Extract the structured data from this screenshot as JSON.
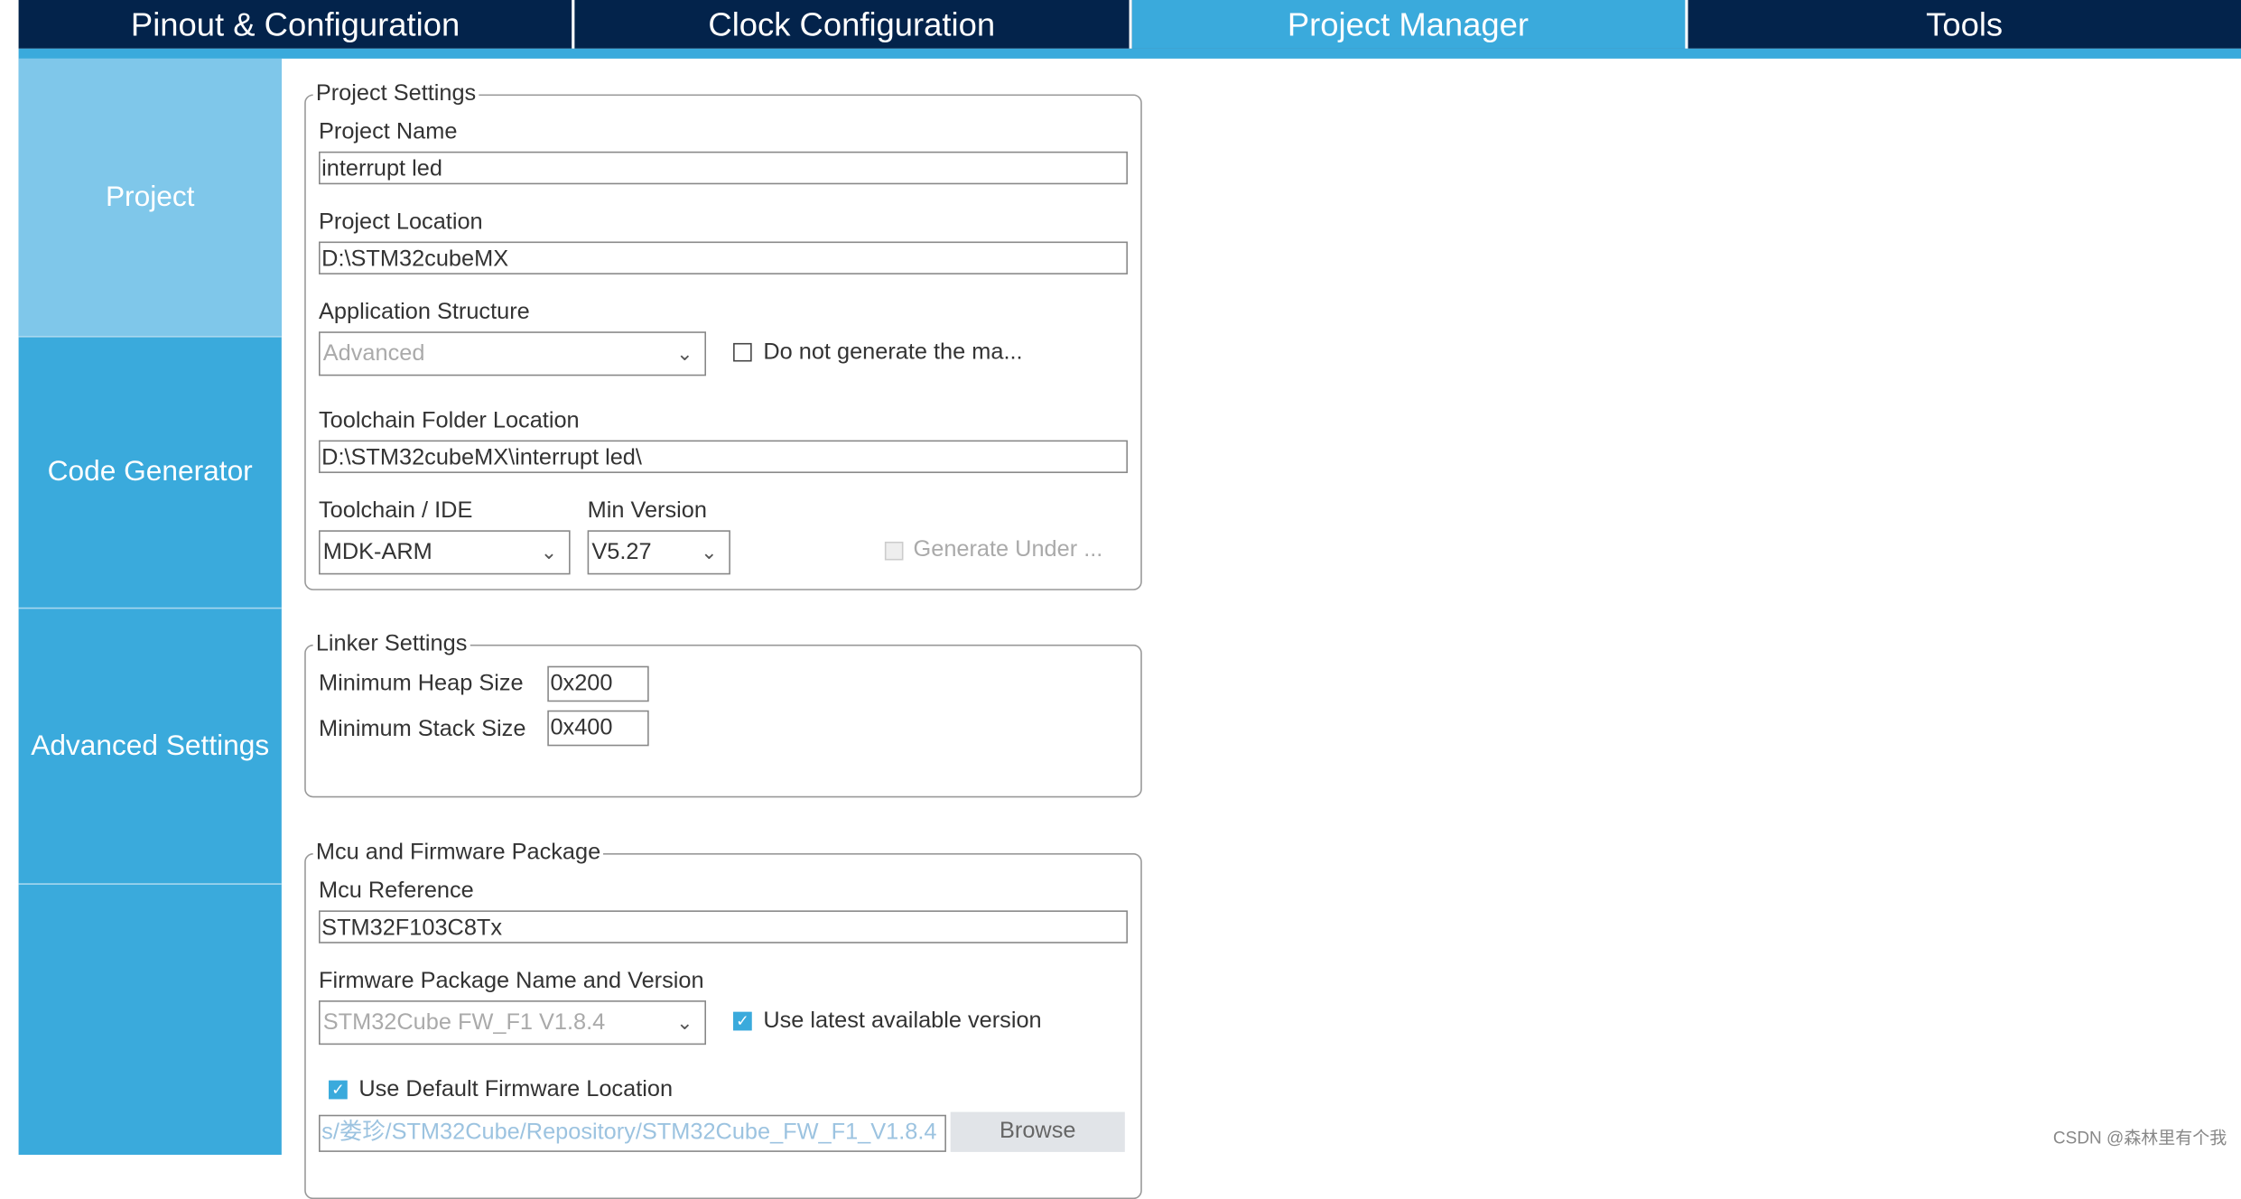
{
  "tabs": [
    "Pinout & Configuration",
    "Clock Configuration",
    "Project Manager",
    "Tools"
  ],
  "active_tab": "Project Manager",
  "sidebar": {
    "items": [
      "Project",
      "Code Generator",
      "Advanced Settings",
      ""
    ],
    "active": "Project"
  },
  "project_settings": {
    "legend": "Project Settings",
    "project_name_label": "Project Name",
    "project_name": "interrupt led",
    "project_location_label": "Project Location",
    "project_location": "D:\\STM32cubeMX",
    "app_structure_label": "Application Structure",
    "app_structure": "Advanced",
    "do_not_generate_label": "Do not generate the ma...",
    "do_not_generate_checked": false,
    "toolchain_folder_label": "Toolchain Folder Location",
    "toolchain_folder": "D:\\STM32cubeMX\\interrupt led\\",
    "toolchain_label": "Toolchain / IDE",
    "toolchain": "MDK-ARM",
    "min_version_label": "Min Version",
    "min_version": "V5.27",
    "generate_under_label": "Generate Under ..."
  },
  "linker_settings": {
    "legend": "Linker Settings",
    "heap_label": "Minimum Heap Size",
    "heap": "0x200",
    "stack_label": "Minimum Stack Size",
    "stack": "0x400"
  },
  "mcu_firmware": {
    "legend": "Mcu and Firmware Package",
    "mcu_ref_label": "Mcu Reference",
    "mcu_ref": "STM32F103C8Tx",
    "fw_label": "Firmware Package Name and Version",
    "fw": "STM32Cube FW_F1 V1.8.4",
    "use_latest_label": "Use latest available version",
    "use_latest_checked": true,
    "use_default_label": "Use Default Firmware Location",
    "use_default_checked": true,
    "fw_location": "s/娄珍/STM32Cube/Repository/STM32Cube_FW_F1_V1.8.4",
    "browse_label": "Browse"
  },
  "watermark": "CSDN @森林里有个我",
  "colors": {
    "tab_bar": "#03234b",
    "accent": "#3aaadc",
    "sidebar_active": "#7fc7ea"
  }
}
